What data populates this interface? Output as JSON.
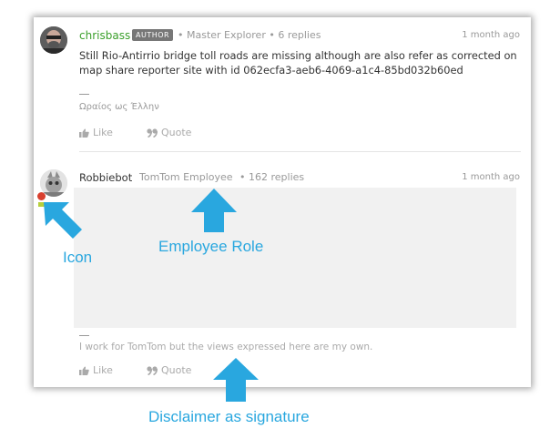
{
  "post1": {
    "username": "chrisbass",
    "badge": "AUTHOR",
    "meta": "• Master Explorer • 6 replies",
    "time": "1 month ago",
    "body": "Still Rio-Antirrio bridge toll roads are missing although are also refer as corrected on map share reporter site with id 062ecfa3-aeb6-4069-a1c4-85bd032b60ed",
    "dash": "—",
    "signature": "Ωραίος ως Έλλην",
    "like_label": "Like",
    "quote_label": "Quote"
  },
  "post2": {
    "username": "Robbiebot",
    "role": "TomTom Employee",
    "meta": "• 162 replies",
    "time": "1 month ago",
    "dash": "—",
    "signature": "I work for TomTom but the views expressed here are my own.",
    "like_label": "Like",
    "quote_label": "Quote"
  },
  "annotations": {
    "icon_label": "Icon",
    "role_label": "Employee Role",
    "disclaimer_label": "Disclaimer as signature",
    "color": "#29a7df"
  },
  "icons": [
    "like-icon",
    "quote-icon"
  ]
}
